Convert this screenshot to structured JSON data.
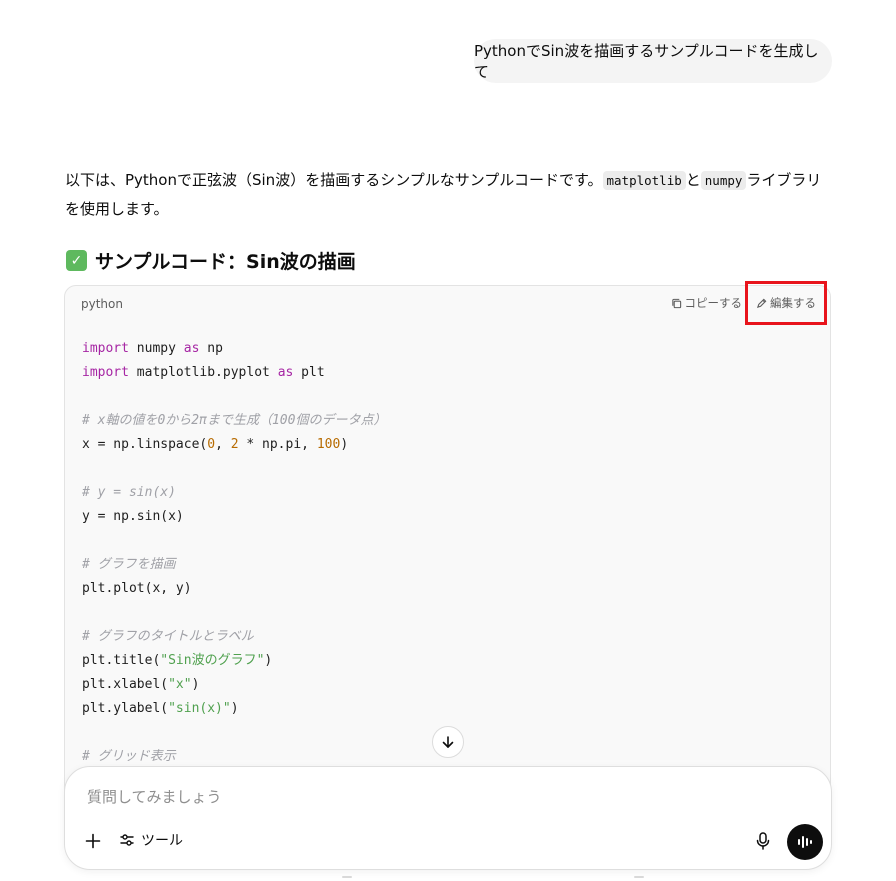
{
  "user_message": "PythonでSin波を描画するサンプルコードを生成して",
  "assistant": {
    "intro_part1": "以下は、Pythonで正弦波（Sin波）を描画するシンプルなサンプルコードです。",
    "intro_code1": "matplotlib",
    "intro_part2": "と",
    "intro_code2": "numpy",
    "intro_part3": "ライブラリを使用します。",
    "heading": "サンプルコード：Sin波の描画",
    "heading_icon": "check-mark-icon"
  },
  "code_block": {
    "language": "python",
    "copy_label": "コピーする",
    "edit_label": "編集する",
    "lines": {
      "l1_kw": "import",
      "l1_rest": " numpy ",
      "l1_kw2": "as",
      "l1_rest2": " np",
      "l2_kw": "import",
      "l2_rest": " matplotlib.pyplot ",
      "l2_kw2": "as",
      "l2_rest2": " plt",
      "l4": "# x軸の値を0から2πまで生成（100個のデータ点）",
      "l5_a": "x = np.linspace(",
      "l5_n1": "0",
      "l5_b": ", ",
      "l5_n2": "2",
      "l5_c": " * np.pi, ",
      "l5_n3": "100",
      "l5_d": ")",
      "l7": "# y = sin(x)",
      "l8": "y = np.sin(x)",
      "l10": "# グラフを描画",
      "l11": "plt.plot(x, y)",
      "l13": "# グラフのタイトルとラベル",
      "l14_a": "plt.title(",
      "l14_s": "\"Sin波のグラフ\"",
      "l14_b": ")",
      "l15_a": "plt.xlabel(",
      "l15_s": "\"x\"",
      "l15_b": ")",
      "l16_a": "plt.ylabel(",
      "l16_s": "\"sin(x)\"",
      "l16_b": ")",
      "l18": "# グリッド表示"
    }
  },
  "composer": {
    "placeholder": "質問してみましょう",
    "tools_label": "ツール"
  },
  "colors": {
    "highlight": "#e8141c",
    "keyword": "#a626a4",
    "comment": "#a0a1a7",
    "number": "#b76b01",
    "string": "#50a14f"
  }
}
